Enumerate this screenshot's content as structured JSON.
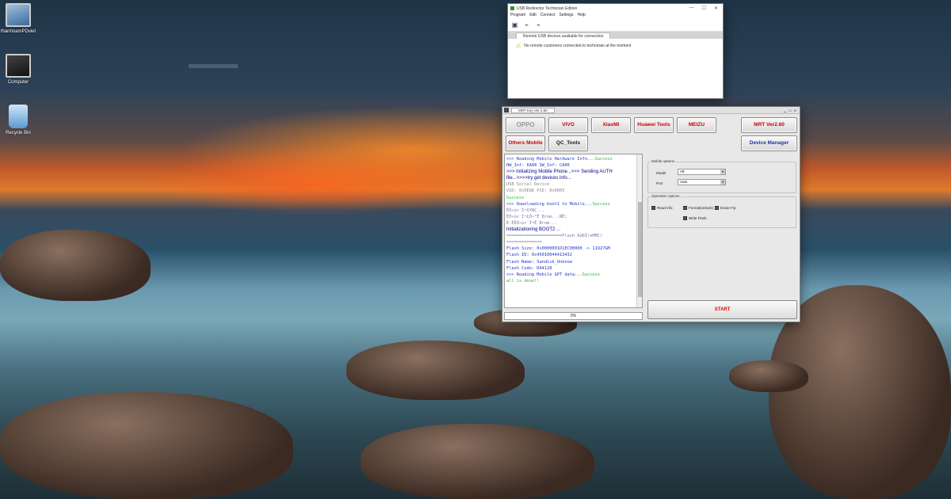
{
  "desktop": {
    "icons": [
      {
        "label": "thanhnamPDviet",
        "icon": "monitor-icon"
      },
      {
        "label": "Computer",
        "icon": "computer-icon"
      },
      {
        "label": "Recycle Bin",
        "icon": "recycle-bin-icon"
      }
    ]
  },
  "usb_window": {
    "title": "USB Redirector Technician Edition",
    "controls": [
      "—",
      "☐",
      "✕"
    ],
    "menu": [
      "Program",
      "Edit",
      "Connect",
      "Settings",
      "Help"
    ],
    "toolbar_icons": [
      "device-icon",
      "usb-plug-icon",
      "usb-plug-icon"
    ],
    "tab": "Remote USB devices available for connection",
    "notice": "No remote customers connected to technician at the moment"
  },
  "mrt_window": {
    "title": "MRT Key Ver 2.60",
    "buttons": {
      "oppo": "OPPO",
      "vivo": "VIVO",
      "xiaomi": "XiaoMi",
      "huawei": "Huawei Tools",
      "meizu": "MEIZU",
      "mrt": "MRT Ver2.60",
      "others": "Others Mobile",
      "qc": "QC_Tools",
      "device_manager": "Device Manager",
      "start": "START"
    },
    "log": [
      {
        "text": ">>> Reading Mobile Hardware Info...",
        "suffix": "Success",
        "color": "blue"
      },
      {
        "text": "   HW_Inf: 6A08   SW_Inf: CA00",
        "color": "blue"
      },
      {
        "text": ">>> Initializing Mobile Phone...>>> Sending AUTH",
        "color": "navy"
      },
      {
        "text": "file...>>>>try get devices info...",
        "color": "navy"
      },
      {
        "text": "   USB Serial Device",
        "color": "dkgray"
      },
      {
        "text": "   VID:  0x0E8D  PID: 0x0003",
        "color": "dkgray"
      },
      {
        "text": "Success",
        "color": "green"
      },
      {
        "text": ">>> Downloading boot1 to Mobile...",
        "suffix": "Success",
        "color": "blue"
      },
      {
        "text": "   ÈÕ»ù×¨Ì¬SYNC...",
        "color": "gray"
      },
      {
        "text": "   ÈÕ»ù×¨Ì¬ÇÒ×²Ê Brom...ÑÊ¦",
        "color": "gray"
      },
      {
        "text": "   È·ÈÈÕ»ù×¨Ì¬Ê Brom...",
        "color": "gray"
      },
      {
        "text": "  Initializationing BOOT2 ...",
        "color": "navy"
      },
      {
        "text": "   ======================Flash ÀàÐÍ(eMMC)",
        "color": "gray"
      },
      {
        "text": "==============",
        "color": "gray"
      },
      {
        "text": "   Flash Size: 0x0000001D1EC00000 -> 11927GM",
        "color": "blue"
      },
      {
        "text": "   Flash  ID: 0x45010044413432",
        "color": "blue"
      },
      {
        "text": "   Flash Name: Sandisk_Unknow",
        "color": "blue"
      },
      {
        "text": "   Flash Code: DA4128",
        "color": "blue"
      },
      {
        "text": ">>> Reading Mobile GPT data...",
        "suffix": "Success",
        "color": "blue"
      },
      {
        "text": "   all is done!!",
        "color": "green"
      }
    ],
    "progress": "0%",
    "mobile_options": {
      "legend": "Mobile options",
      "model_label": "Model",
      "model_value": "A9",
      "port_label": "Port",
      "port_value": "Auto"
    },
    "operation_options": {
      "legend": "Operation options",
      "items": [
        "Read Info",
        "Format(Unlock)",
        "Erase Frp",
        "Write Flash"
      ]
    }
  }
}
